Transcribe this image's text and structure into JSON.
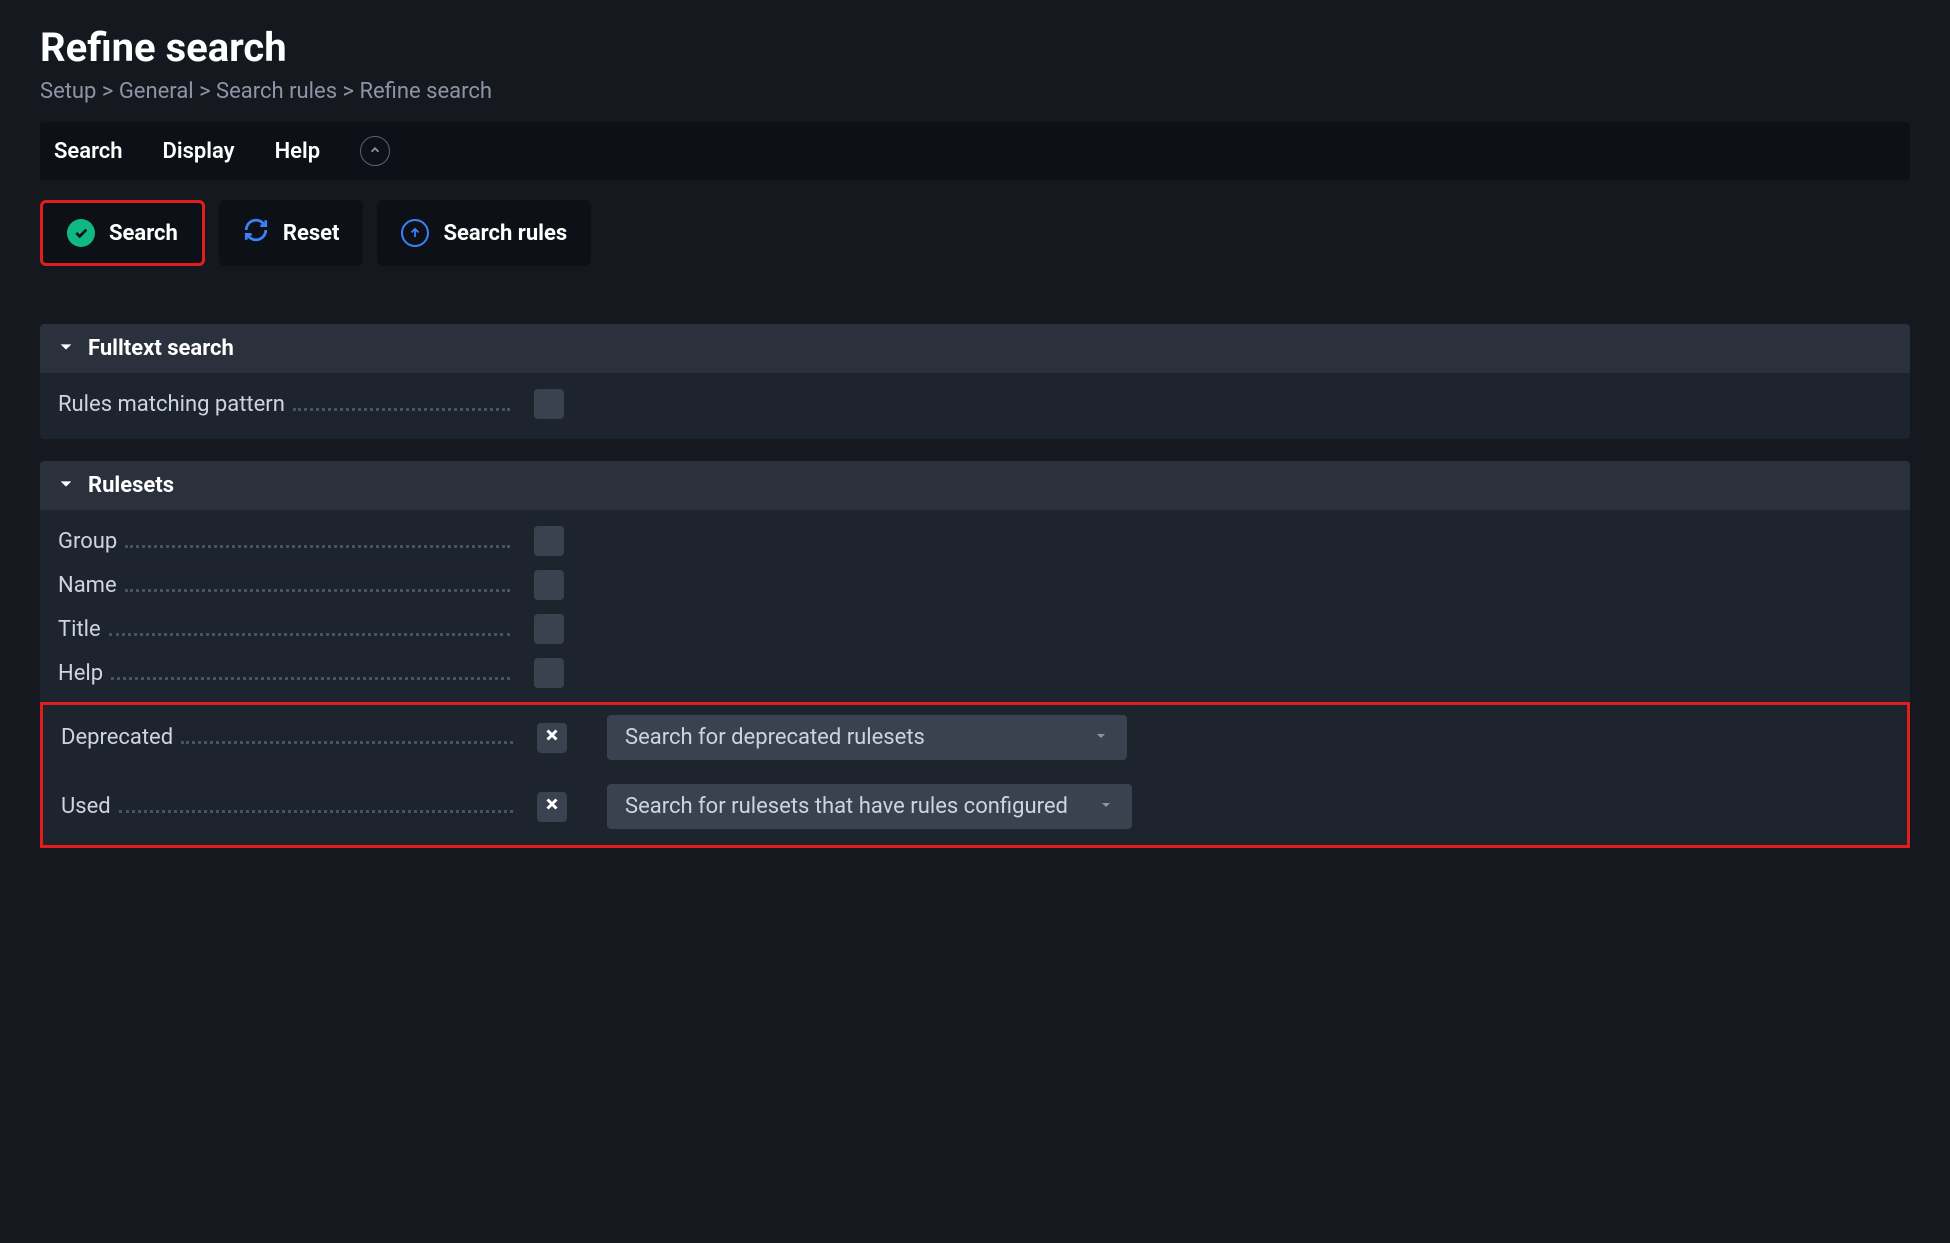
{
  "page": {
    "title": "Refine search",
    "breadcrumb": "Setup > General > Search rules > Refine search"
  },
  "menu": {
    "items": [
      "Search",
      "Display",
      "Help"
    ]
  },
  "actions": {
    "search": "Search",
    "reset": "Reset",
    "searchRules": "Search rules"
  },
  "sections": {
    "fulltext": {
      "title": "Fulltext search",
      "rows": [
        {
          "label": "Rules matching pattern",
          "checked": false
        }
      ]
    },
    "rulesets": {
      "title": "Rulesets",
      "rows": [
        {
          "label": "Group",
          "checked": false
        },
        {
          "label": "Name",
          "checked": false
        },
        {
          "label": "Title",
          "checked": false
        },
        {
          "label": "Help",
          "checked": false
        },
        {
          "label": "Deprecated",
          "checked": true,
          "select": "Search for deprecated rulesets"
        },
        {
          "label": "Used",
          "checked": true,
          "select": "Search for rulesets that have rules configured"
        }
      ]
    }
  }
}
